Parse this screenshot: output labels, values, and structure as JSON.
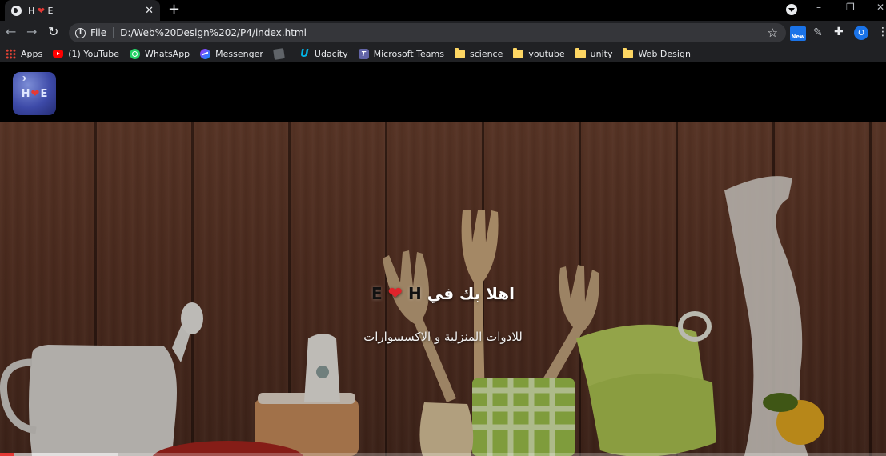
{
  "browser": {
    "tab": {
      "title_left": "H",
      "title_heart": "❤",
      "title_right": "E",
      "close": "✕"
    },
    "new_tab": "+",
    "window_controls": {
      "minimize": "–",
      "restore": "❐",
      "close": "✕"
    },
    "nav": {
      "back": "←",
      "forward": "→",
      "reload": "↻"
    },
    "omnibox": {
      "info": "i",
      "scheme": "File",
      "url": "D:/Web%20Design%202/P4/index.html",
      "star": "☆"
    },
    "extensions": {
      "new_badge": "New",
      "pen": "✎",
      "puzzle": "✚",
      "avatar": "O",
      "menu": "⋮"
    }
  },
  "bookmarks": [
    {
      "label": "Apps",
      "icon": "apps-grid-icon"
    },
    {
      "label": "(1) YouTube",
      "icon": "youtube-icon"
    },
    {
      "label": "WhatsApp",
      "icon": "whatsapp-icon"
    },
    {
      "label": "Messenger",
      "icon": "messenger-icon"
    },
    {
      "label": "",
      "icon": "bookmark-icon"
    },
    {
      "label": "Udacity",
      "icon": "udacity-icon"
    },
    {
      "label": "Microsoft Teams",
      "icon": "teams-icon"
    },
    {
      "label": "science",
      "icon": "folder-icon"
    },
    {
      "label": "youtube",
      "icon": "folder-icon"
    },
    {
      "label": "unity",
      "icon": "folder-icon"
    },
    {
      "label": "Web Design",
      "icon": "folder-icon"
    }
  ],
  "site": {
    "logo": {
      "left": "H",
      "heart": "❤",
      "right": "E"
    },
    "hero": {
      "title_prefix": "اهلا بك في",
      "brand_e": "E",
      "brand_heart": "❤",
      "brand_h": "H",
      "subtitle": "للادوات المنزلية و الاكسسوارات"
    }
  },
  "video_progress": {
    "played_fraction": 0.016,
    "buffered_fraction": 0.133
  },
  "colors": {
    "accent_red": "#e53935",
    "chrome_dark": "#202124",
    "omnibox": "#35363a",
    "wood": "#5a3324"
  }
}
